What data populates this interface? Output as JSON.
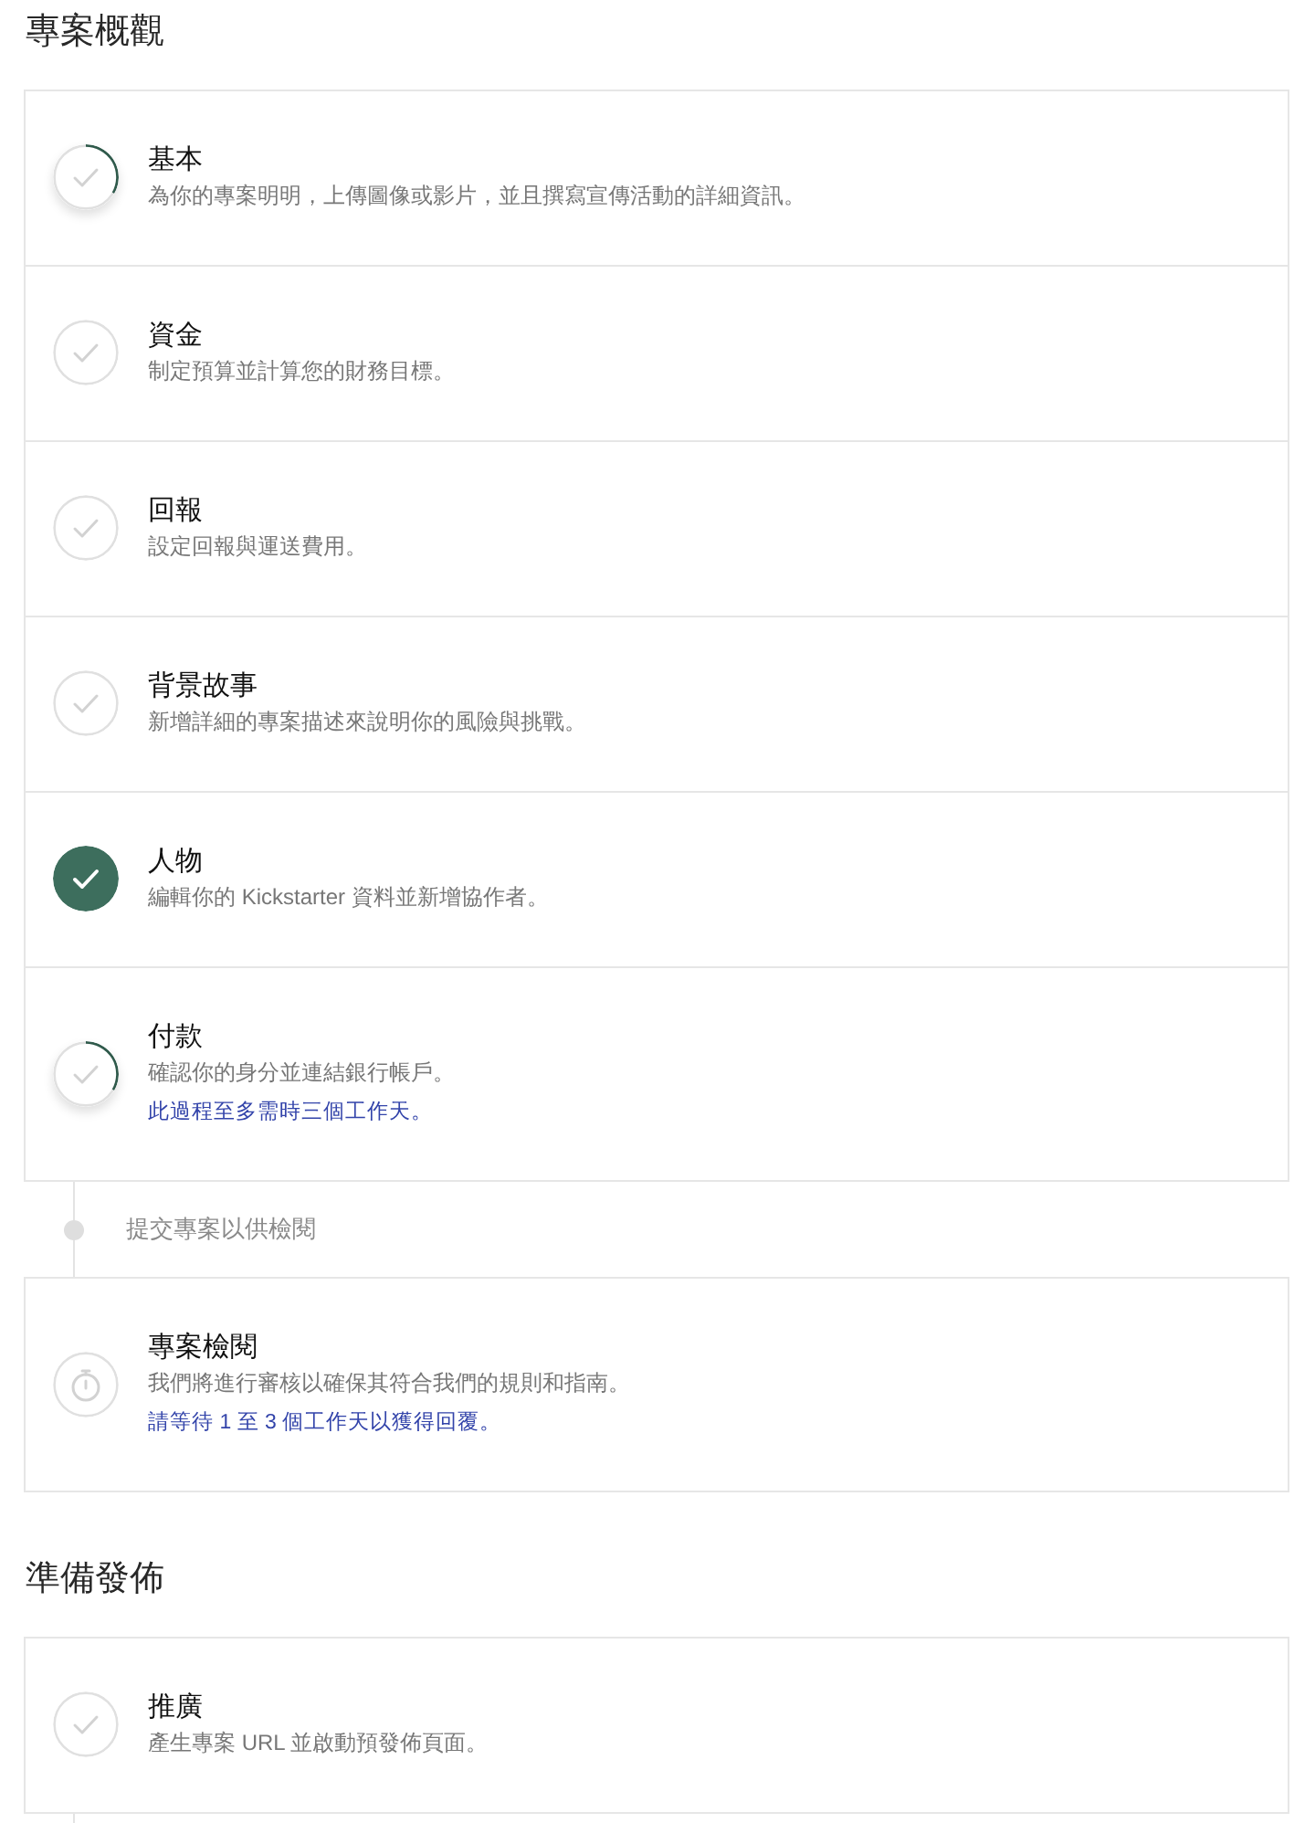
{
  "sections": [
    {
      "heading": "專案概觀",
      "groups": [
        {
          "kind": "card",
          "steps": [
            {
              "kind": "task",
              "title": "基本",
              "description": "為你的專案明明，上傳圖像或影片，並且撰寫宣傳活動的詳細資訊。",
              "completed": false,
              "in_progress": true
            },
            {
              "kind": "task",
              "title": "資金",
              "description": "制定預算並計算您的財務目標。",
              "completed": false,
              "in_progress": false
            },
            {
              "kind": "task",
              "title": "回報",
              "description": "設定回報與運送費用。",
              "completed": false,
              "in_progress": false
            },
            {
              "kind": "task",
              "title": "背景故事",
              "description": "新增詳細的專案描述來說明你的風險與挑戰。",
              "completed": false,
              "in_progress": false
            },
            {
              "kind": "task",
              "title": "人物",
              "description": "編輯你的 Kickstarter 資料並新增協作者。",
              "completed": true,
              "in_progress": false
            },
            {
              "kind": "task",
              "title": "付款",
              "description": "確認你的身分並連結銀行帳戶。",
              "note": "此過程至多需時三個工作天。",
              "completed": false,
              "in_progress": true
            }
          ]
        },
        {
          "kind": "milestone",
          "label": "提交專案以供檢閱"
        },
        {
          "kind": "card",
          "steps": [
            {
              "kind": "review",
              "title": "專案檢閱",
              "description": "我們將進行審核以確保其符合我們的規則和指南。",
              "note": "請等待 1 至 3 個工作天以獲得回覆。",
              "completed": false,
              "in_progress": false
            }
          ]
        }
      ]
    },
    {
      "heading": "準備發佈",
      "groups": [
        {
          "kind": "card",
          "steps": [
            {
              "kind": "task",
              "title": "推廣",
              "description": "產生專案 URL 並啟動預發佈頁面。",
              "completed": false,
              "in_progress": false
            }
          ]
        }
      ]
    }
  ]
}
